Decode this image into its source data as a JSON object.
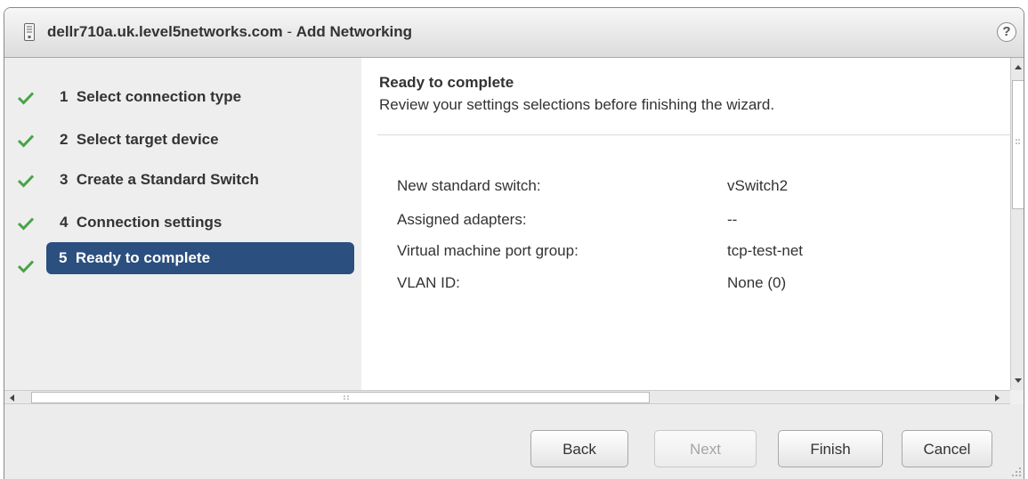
{
  "window": {
    "title_host": "dellr710a.uk.level5networks.com",
    "title_sep": " - ",
    "title_action": "Add Networking",
    "help_label": "?"
  },
  "steps": [
    {
      "label": "1  Select connection type",
      "done": true
    },
    {
      "label": "2  Select target device",
      "done": true
    },
    {
      "label": "3  Create a Standard Switch",
      "done": true
    },
    {
      "label": "4  Connection settings",
      "done": true
    },
    {
      "label": "5  Ready to complete",
      "done": true,
      "active": true
    }
  ],
  "content": {
    "title": "Ready to complete",
    "subtitle": "Review your settings selections before finishing the wizard.",
    "rows": [
      {
        "key": "New standard switch:",
        "value": "vSwitch2"
      },
      {
        "key": "Assigned adapters:",
        "value": "--"
      },
      {
        "key": "Virtual machine port group:",
        "value": "tcp-test-net"
      },
      {
        "key": "VLAN ID:",
        "value": "None (0)"
      }
    ]
  },
  "buttons": {
    "back": "Back",
    "next": "Next",
    "finish": "Finish",
    "cancel": "Cancel"
  },
  "colors": {
    "active_step": "#2b4f7e",
    "check": "#47a447"
  }
}
